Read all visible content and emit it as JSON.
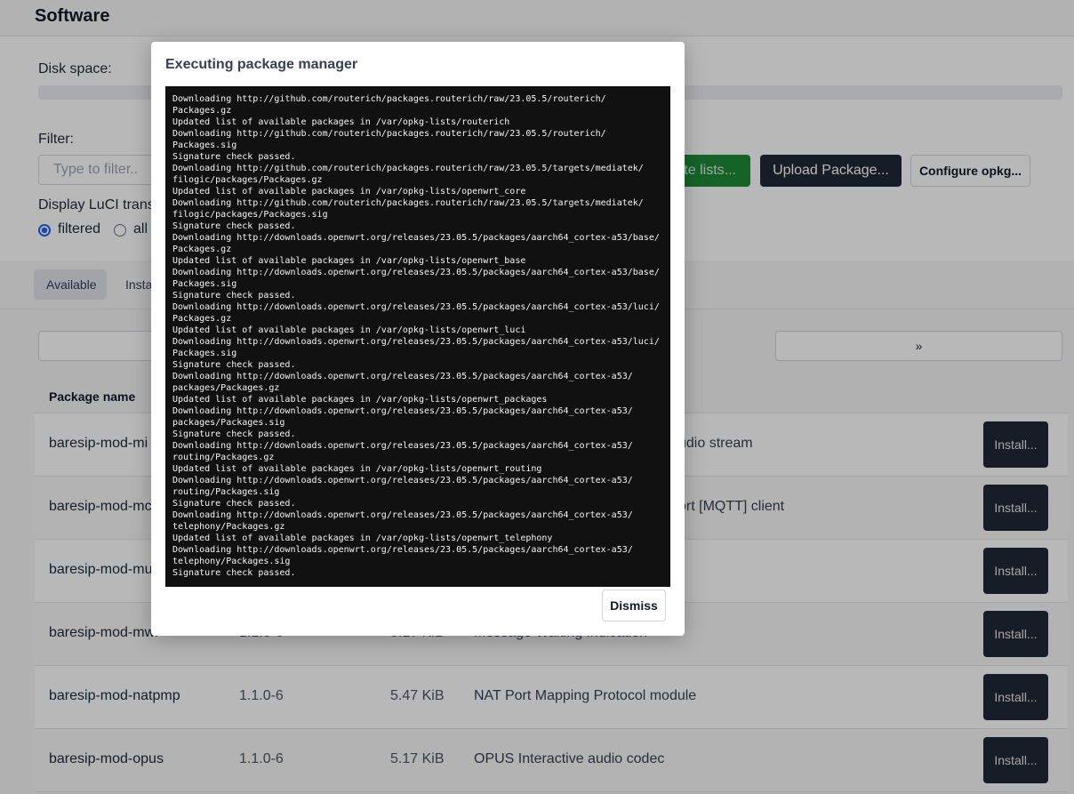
{
  "page": {
    "title": "Software",
    "disk_space_label": "Disk space:",
    "filter_label": "Filter:",
    "filter_placeholder": "Type to filter...",
    "display_translations_label": "Display LuCI trans",
    "radio_filtered": "filtered",
    "radio_all": "all",
    "update_lists_button": "te lists...",
    "upload_package_button": "Upload Package...",
    "configure_opkg_button": "Configure opkg...",
    "tabs": [
      {
        "label": "Available"
      },
      {
        "label": "Insta"
      }
    ],
    "pager_next": "»"
  },
  "table": {
    "headers": {
      "name": "Package name"
    },
    "install_label": "Install...",
    "rows": [
      {
        "name": "baresip-mod-mi",
        "version": "",
        "size": "",
        "description": "udio stream"
      },
      {
        "name": "baresip-mod-mc",
        "version": "",
        "size": "",
        "description": "ort [MQTT] client"
      },
      {
        "name": "baresip-mod-mu",
        "version": "",
        "size": "",
        "description": ""
      },
      {
        "name": "baresip-mod-mwi",
        "version": "1.1.0-6",
        "size": "5.17 KiB",
        "description": "Message Waiting Indication"
      },
      {
        "name": "baresip-mod-natpmp",
        "version": "1.1.0-6",
        "size": "5.47 KiB",
        "description": "NAT Port Mapping Protocol module"
      },
      {
        "name": "baresip-mod-opus",
        "version": "1.1.0-6",
        "size": "5.17 KiB",
        "description": "OPUS Interactive audio codec"
      }
    ]
  },
  "modal": {
    "title": "Executing package manager",
    "dismiss_label": "Dismiss",
    "output_lines": [
      "Downloading http://github.com/routerich/packages.routerich/raw/23.05.5/routerich/",
      "Packages.gz",
      "Updated list of available packages in /var/opkg-lists/routerich",
      "Downloading http://github.com/routerich/packages.routerich/raw/23.05.5/routerich/",
      "Packages.sig",
      "Signature check passed.",
      "Downloading http://github.com/routerich/packages.routerich/raw/23.05.5/targets/mediatek/",
      "filogic/packages/Packages.gz",
      "Updated list of available packages in /var/opkg-lists/openwrt_core",
      "Downloading http://github.com/routerich/packages.routerich/raw/23.05.5/targets/mediatek/",
      "filogic/packages/Packages.sig",
      "Signature check passed.",
      "Downloading http://downloads.openwrt.org/releases/23.05.5/packages/aarch64_cortex-a53/base/",
      "Packages.gz",
      "Updated list of available packages in /var/opkg-lists/openwrt_base",
      "Downloading http://downloads.openwrt.org/releases/23.05.5/packages/aarch64_cortex-a53/base/",
      "Packages.sig",
      "Signature check passed.",
      "Downloading http://downloads.openwrt.org/releases/23.05.5/packages/aarch64_cortex-a53/luci/",
      "Packages.gz",
      "Updated list of available packages in /var/opkg-lists/openwrt_luci",
      "Downloading http://downloads.openwrt.org/releases/23.05.5/packages/aarch64_cortex-a53/luci/",
      "Packages.sig",
      "Signature check passed.",
      "Downloading http://downloads.openwrt.org/releases/23.05.5/packages/aarch64_cortex-a53/",
      "packages/Packages.gz",
      "Updated list of available packages in /var/opkg-lists/openwrt_packages",
      "Downloading http://downloads.openwrt.org/releases/23.05.5/packages/aarch64_cortex-a53/",
      "packages/Packages.sig",
      "Signature check passed.",
      "Downloading http://downloads.openwrt.org/releases/23.05.5/packages/aarch64_cortex-a53/",
      "routing/Packages.gz",
      "Updated list of available packages in /var/opkg-lists/openwrt_routing",
      "Downloading http://downloads.openwrt.org/releases/23.05.5/packages/aarch64_cortex-a53/",
      "routing/Packages.sig",
      "Signature check passed.",
      "Downloading http://downloads.openwrt.org/releases/23.05.5/packages/aarch64_cortex-a53/",
      "telephony/Packages.gz",
      "Updated list of available packages in /var/opkg-lists/openwrt_telephony",
      "Downloading http://downloads.openwrt.org/releases/23.05.5/packages/aarch64_cortex-a53/",
      "telephony/Packages.sig",
      "Signature check passed."
    ]
  }
}
